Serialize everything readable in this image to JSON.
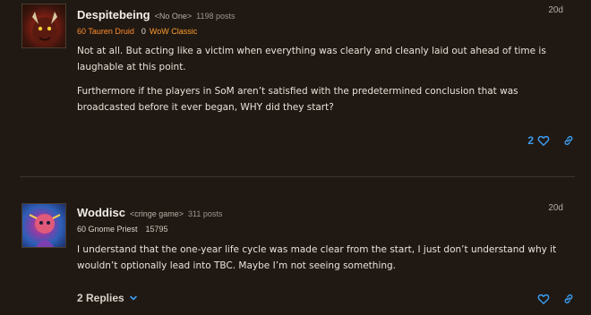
{
  "posts": [
    {
      "username": "Despitebeing",
      "title_tag": "<No One>",
      "post_count": "1198 posts",
      "class_line": "60 Tauren Druid",
      "stat": "0",
      "realm": "WoW Classic",
      "date": "20d",
      "paragraphs": [
        "Not at all. But acting like a victim when everything was clearly and cleanly laid out ahead of time is laughable at this point.",
        "Furthermore if the players in SoM aren’t satisfied with the predetermined conclusion that was broadcasted before it ever began, WHY did they start?"
      ],
      "likes": "2"
    },
    {
      "username": "Woddisc",
      "title_tag": "<cringe game>",
      "post_count": "311 posts",
      "class_line": "60 Gnome Priest",
      "stat": "15795",
      "date": "20d",
      "paragraphs": [
        "I understand that the one-year life cycle was made clear from the start, I just don’t understand why it wouldn’t optionally lead into TBC. Maybe I’m not seeing something."
      ],
      "replies_label": "2 Replies"
    }
  ],
  "icons": {
    "like": "heart-icon",
    "share": "link-icon",
    "expand": "chevron-down-icon"
  },
  "colors": {
    "background": "#201913",
    "accent_blue": "#3a9cf0",
    "class_orange": "#ff8a2b"
  }
}
